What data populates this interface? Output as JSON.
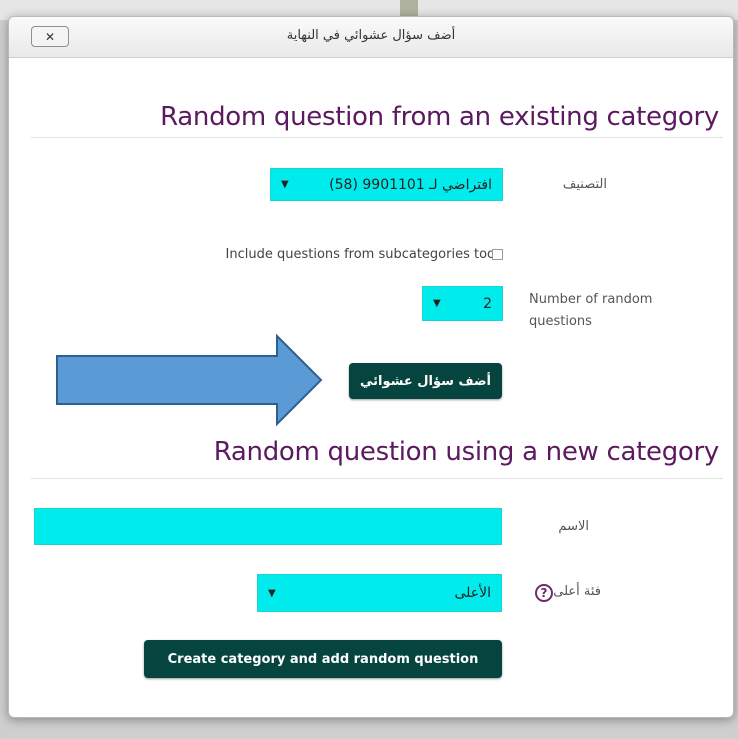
{
  "dialog": {
    "title": "أضف سؤال عشوائي في النهاية",
    "close_label": "✕"
  },
  "existing": {
    "heading": "Random question from an existing category",
    "category_label": "التصنيف",
    "category_value": "افتراضي لـ 9901101 (58)",
    "subcategories_label": "Include questions from subcategories too",
    "subcategories_checked": false,
    "number_label_line1": "Number of random",
    "number_label_line2": "questions",
    "number_value": "2",
    "add_button": "أضف سؤال عشوائي"
  },
  "newcat": {
    "heading": "Random question using a new category",
    "name_label": "الاسم",
    "name_value": "",
    "parent_label": "فئة أعلى",
    "parent_value": "الأعلى",
    "create_button": "Create category and add random question"
  },
  "icons": {
    "dropdown": "chevron-down-icon",
    "help": "help-icon",
    "close": "close-icon",
    "arrow": "right-arrow-icon"
  },
  "colors": {
    "heading": "#5b1a5f",
    "field": "#00ecec",
    "button": "#06453f",
    "arrow_fill": "#5b9bd5",
    "arrow_stroke": "#2f5f8f"
  }
}
